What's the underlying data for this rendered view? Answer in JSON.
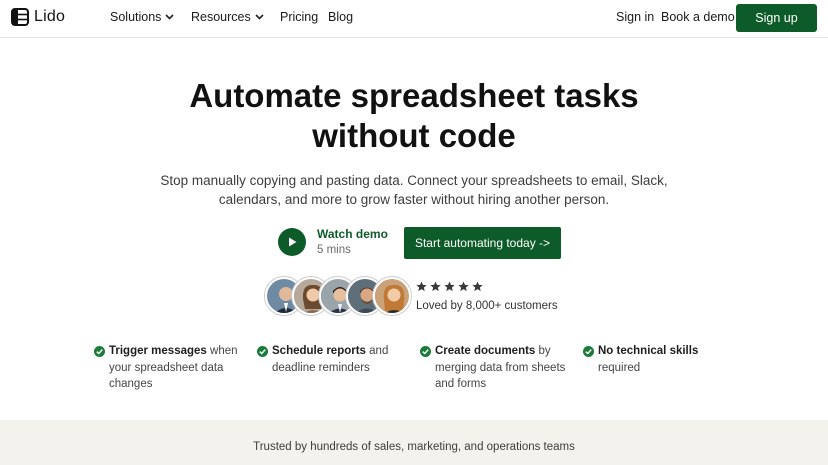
{
  "brand": {
    "name": "Lido",
    "accent": "#0e5b2a"
  },
  "nav": {
    "items": [
      {
        "label": "Solutions",
        "dropdown": true
      },
      {
        "label": "Resources",
        "dropdown": true
      },
      {
        "label": "Pricing",
        "dropdown": false
      },
      {
        "label": "Blog",
        "dropdown": false
      }
    ],
    "sign_in": "Sign in",
    "book_demo": "Book a demo",
    "sign_up": "Sign up"
  },
  "hero": {
    "title_line1": "Automate spreadsheet tasks",
    "title_line2": "without code",
    "subtitle": "Stop manually copying and pasting data. Connect your spreadsheets to email, Slack, calendars, and more to grow faster without hiring another person.",
    "watch_label": "Watch demo",
    "watch_length": "5 mins",
    "cta_label": "Start automating today ->"
  },
  "social_proof": {
    "rating_stars": 5,
    "loved_text": "Loved by 8,000+ customers"
  },
  "features": [
    {
      "bold": "Trigger messages",
      "rest": " when your spreadsheet data changes"
    },
    {
      "bold": "Schedule reports",
      "rest": " and deadline reminders"
    },
    {
      "bold": "Create documents",
      "rest": " by merging data from sheets and forms"
    },
    {
      "bold": "No technical skills",
      "rest": " required"
    }
  ],
  "trusted": {
    "text": "Trusted by hundreds of sales, marketing, and operations teams"
  }
}
